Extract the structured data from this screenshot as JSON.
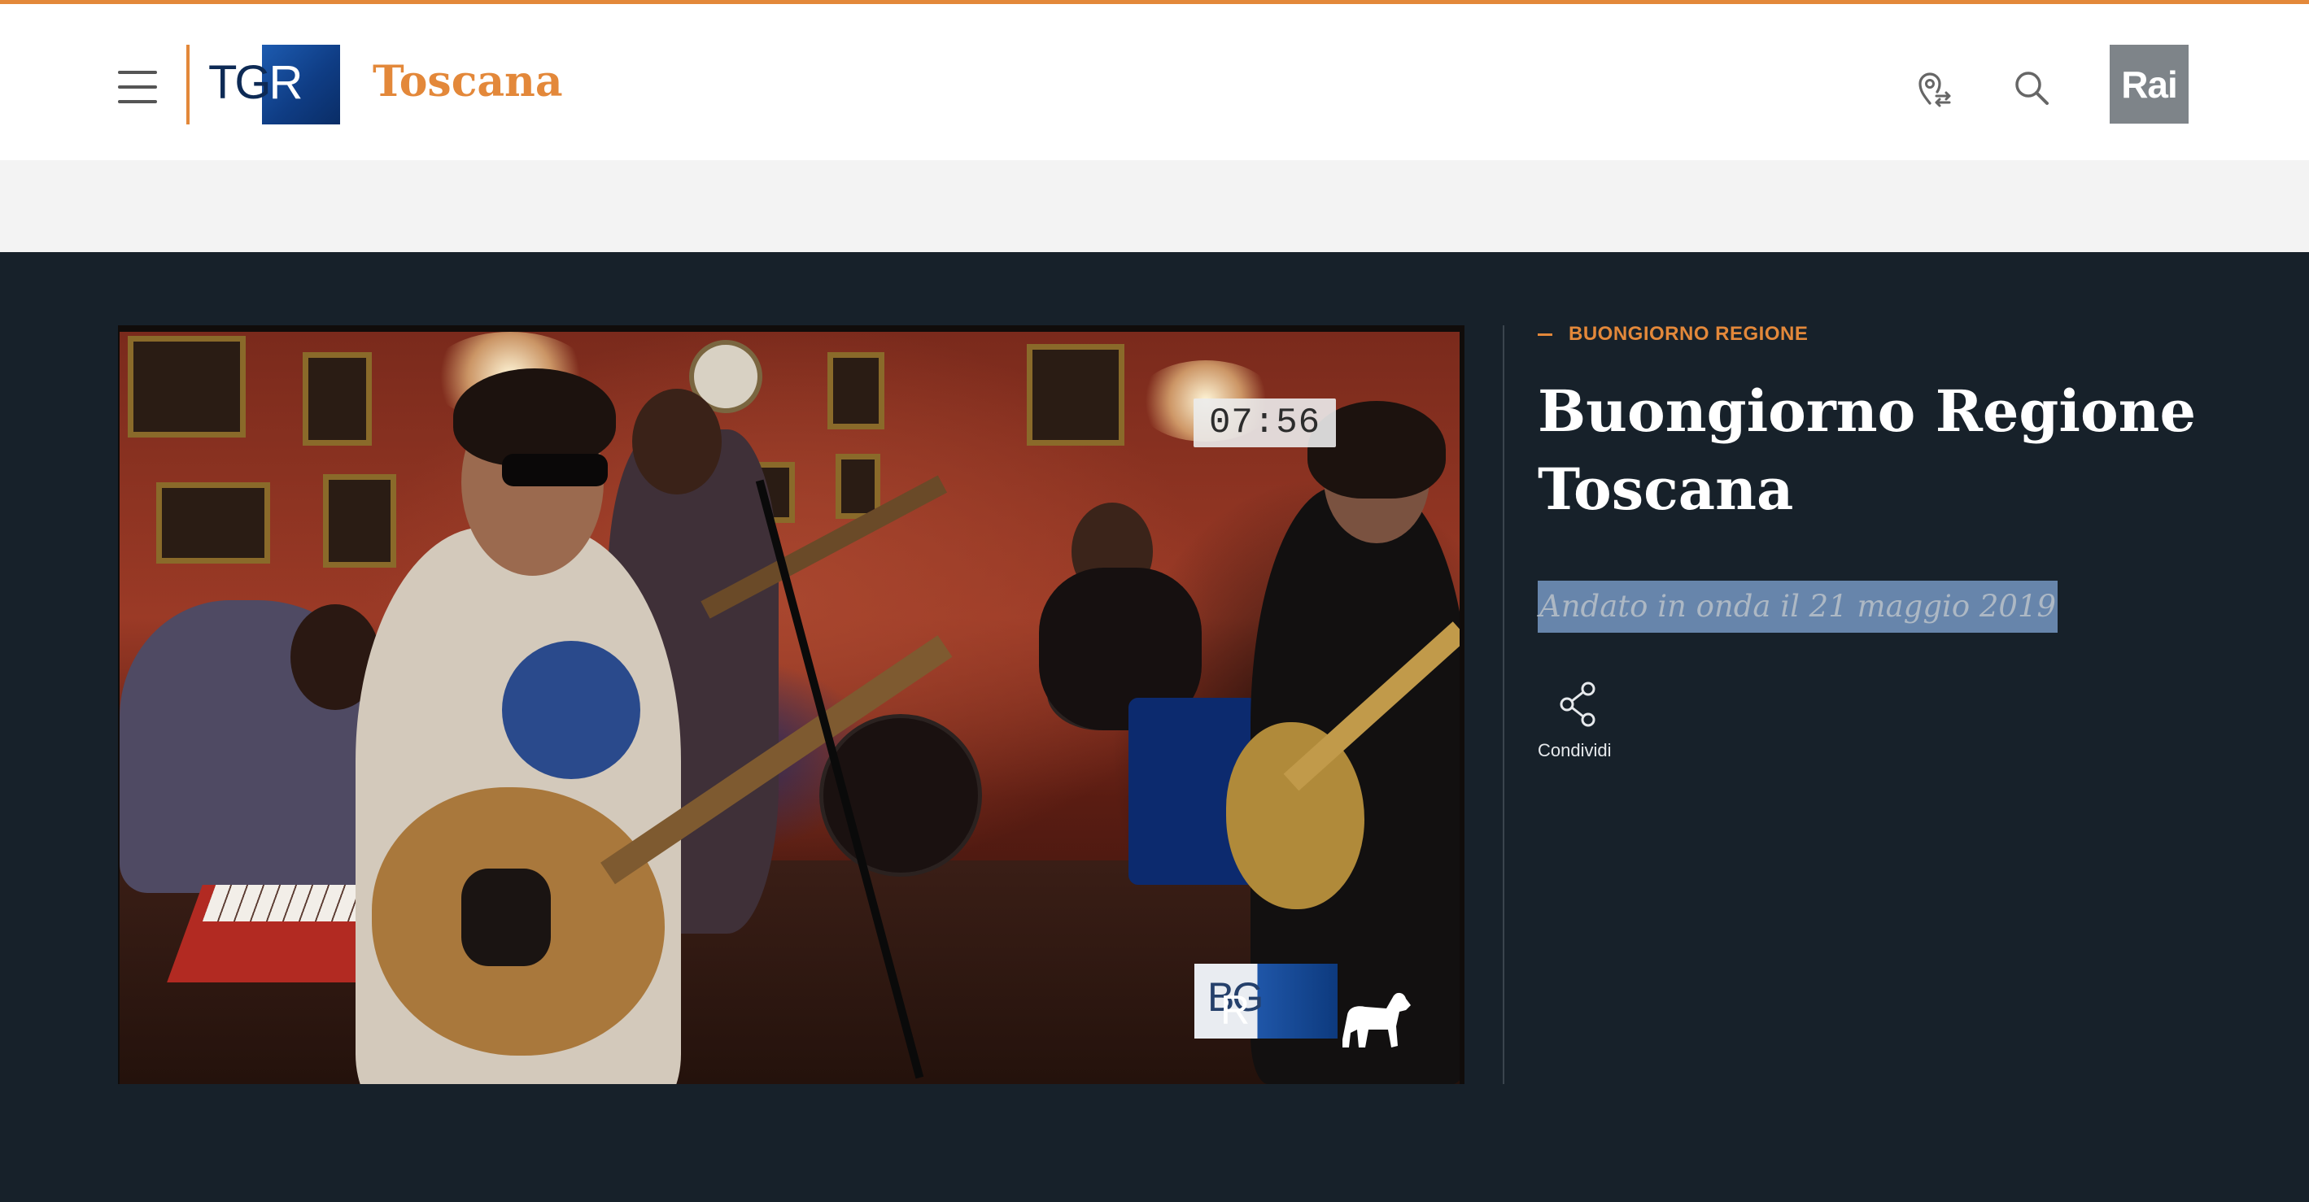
{
  "colors": {
    "accent": "#e3883a",
    "dark_background": "#17212a",
    "header_background": "#ffffff",
    "grey_band": "#f3f3f3",
    "selection_highlight": "#6785ab"
  },
  "header": {
    "menu_icon": "hamburger-icon",
    "logo": {
      "letters": "TGR"
    },
    "region": "Toscana",
    "icons": [
      "location-switch-icon",
      "search-icon"
    ],
    "rai_logo": "Rai"
  },
  "video": {
    "timestamp": "07:56",
    "overlay_logo": {
      "letters": "BGR"
    },
    "watermark_icon": "dog-icon"
  },
  "article": {
    "kicker": "BUONGIORNO REGIONE",
    "title": "Buongiorno Regione Toscana",
    "aired": "Andato in onda il 21 maggio 2019",
    "share": {
      "icon": "share-icon",
      "label": "Condividi"
    }
  }
}
